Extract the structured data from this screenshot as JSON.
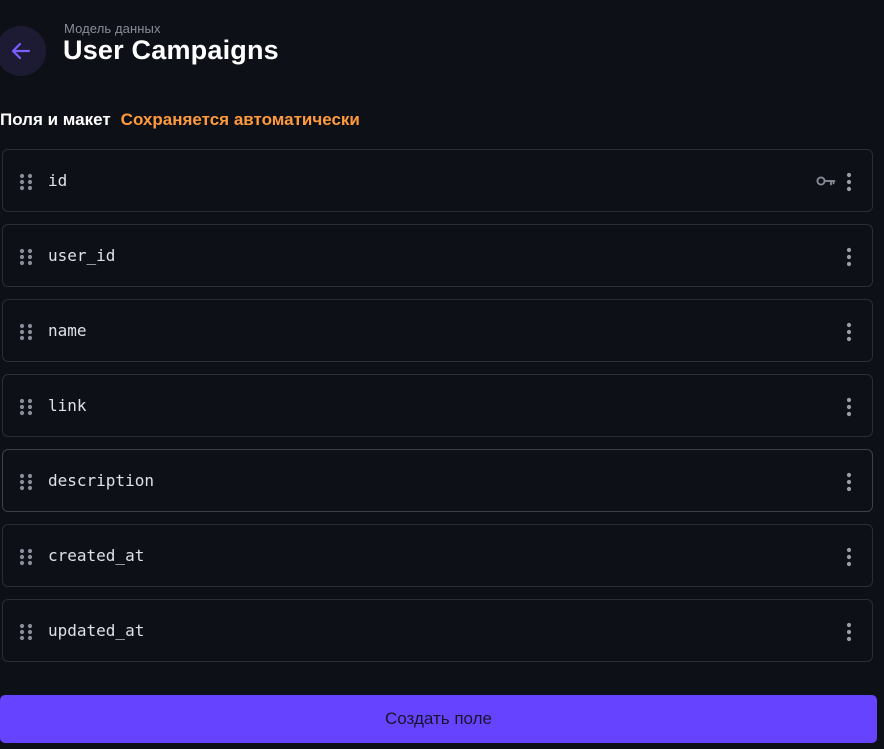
{
  "header": {
    "subtitle": "Модель данных",
    "title": "User Campaigns",
    "back_icon": "arrow-left-icon"
  },
  "section": {
    "title": "Поля и макет",
    "autosave_note": "Сохраняется автоматически"
  },
  "fields": [
    {
      "name": "id",
      "primary_key": true
    },
    {
      "name": "user_id",
      "primary_key": false
    },
    {
      "name": "name",
      "primary_key": false
    },
    {
      "name": "link",
      "primary_key": false
    },
    {
      "name": "description",
      "primary_key": false
    },
    {
      "name": "created_at",
      "primary_key": false
    },
    {
      "name": "updated_at",
      "primary_key": false
    }
  ],
  "create_button_label": "Создать поле",
  "colors": {
    "background": "#0e1017",
    "accent": "#6644ff",
    "autosave": "#ff9a3c",
    "border": "#2a2d37"
  }
}
